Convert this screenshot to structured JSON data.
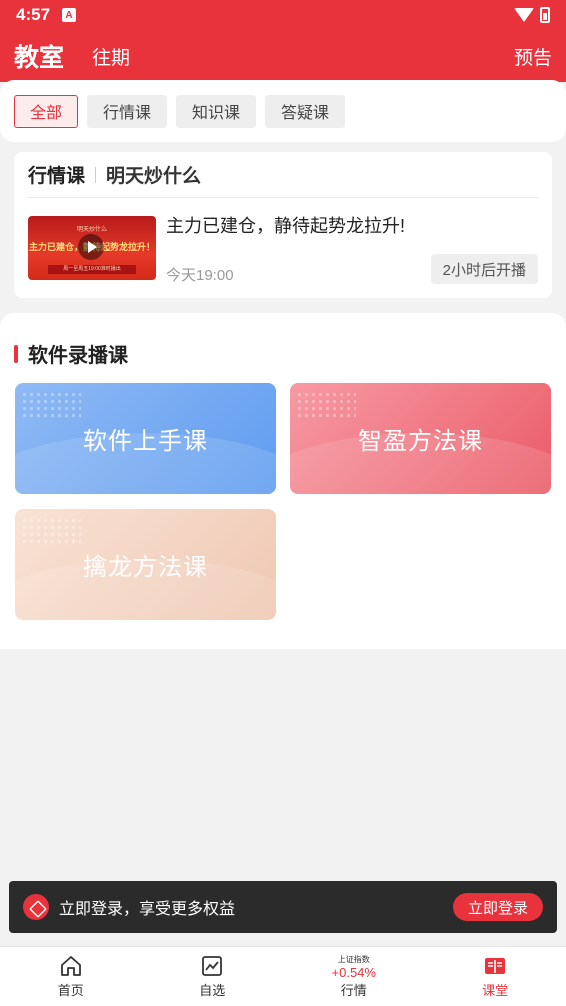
{
  "status_bar": {
    "time": "4:57",
    "notif_icon": "A"
  },
  "header": {
    "title": "教室",
    "tab_past": "往期",
    "preview": "预告"
  },
  "filters": {
    "items": [
      "全部",
      "行情课",
      "知识课",
      "答疑课"
    ],
    "active": "全部"
  },
  "market_course": {
    "section_label": "行情课",
    "subtitle": "明天炒什么",
    "thumb_title": "明天炒什么",
    "thumb_headline": "主力已建仓，静待起势龙拉升！",
    "thumb_footer": "周一至周五19:00准时播出",
    "title": "主力已建仓，静待起势龙拉升!",
    "time": "今天19:00",
    "badge": "2小时后开播"
  },
  "recorded": {
    "title": "软件录播课",
    "courses": [
      "软件上手课",
      "智盈方法课",
      "擒龙方法课"
    ]
  },
  "login_bar": {
    "text": "立即登录，享受更多权益",
    "button": "立即登录"
  },
  "tabbar": {
    "home": "首页",
    "watchlist": "自选",
    "market_sub": "上证指数",
    "market_value": "+0.54%",
    "market": "行情",
    "classroom": "课堂"
  },
  "colors": {
    "brand": "#e8323c"
  }
}
